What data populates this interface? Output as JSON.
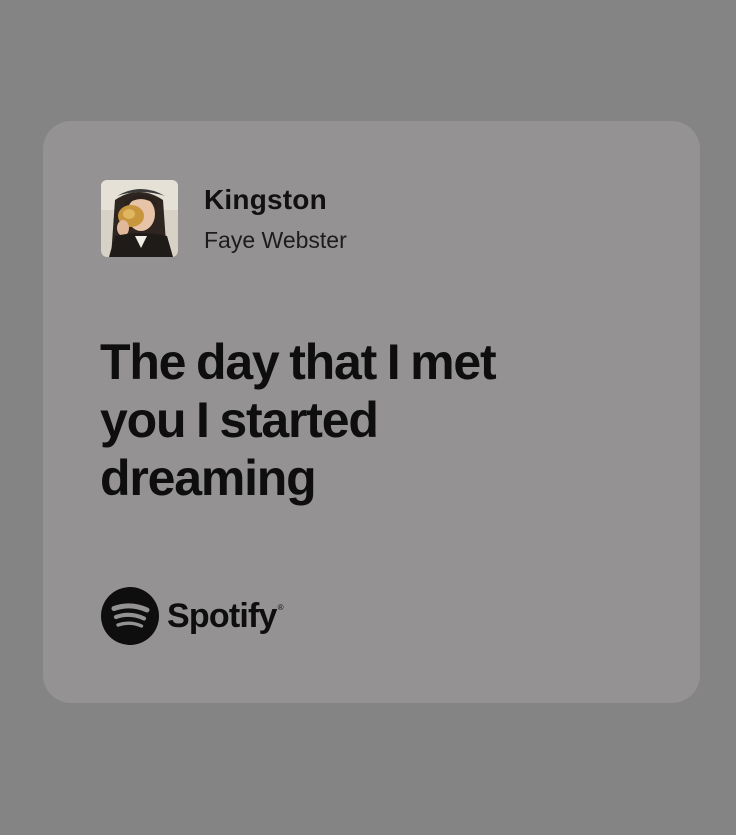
{
  "colors": {
    "background": "#858485",
    "card": "#949293",
    "text": "#0e0e0e"
  },
  "track": {
    "title": "Kingston",
    "artist": "Faye Webster"
  },
  "lyrics": "The day that I met you I started dreaming",
  "brand": {
    "name": "Spotify",
    "trademark": "®",
    "logo_icon": "spotify-logo-icon"
  }
}
